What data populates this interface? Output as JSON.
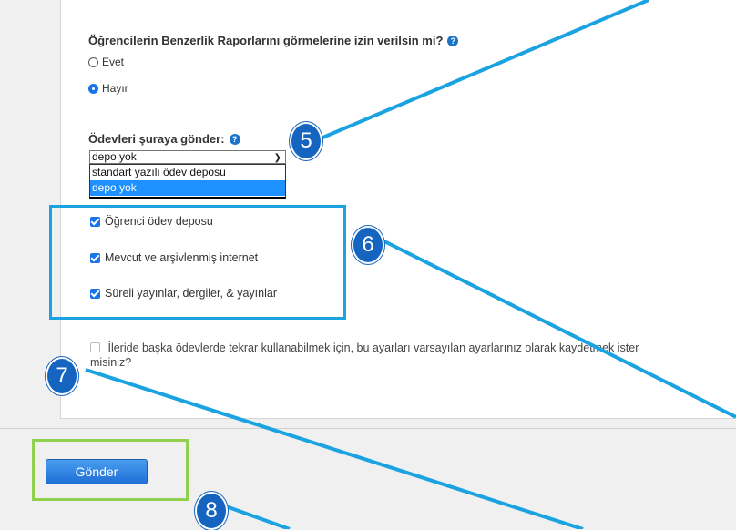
{
  "similarity_question": "Öğrencilerin Benzerlik Raporlarını görmelerine izin verilsin mi?",
  "radio_options": [
    "Evet",
    "Hayır"
  ],
  "radio_selected": "Hayır",
  "submit_to_label": "Ödevleri şuraya gönder:",
  "submit_to_value": "depo yok",
  "dropdown_options": [
    "standart yazılı ödev deposu",
    "depo yok"
  ],
  "search_options": [
    "Öğrenci ödev deposu",
    "Mevcut ve arşivlenmiş internet",
    "Süreli yayınlar, dergiler, & yayınlar"
  ],
  "save_defaults_text": "İleride başka ödevlerde tekrar kullanabilmek için, bu ayarları varsayılan ayarlarınız olarak kaydetmek ister misiniz?",
  "submit_button": "Gönder",
  "callouts": [
    "5",
    "6",
    "7",
    "8"
  ],
  "help_icon": "question-circle-icon",
  "colors": {
    "accent": "#1a73e8",
    "callout": "#1565c0",
    "highlight_blue": "#1aa3e0",
    "highlight_green": "#92d050"
  }
}
